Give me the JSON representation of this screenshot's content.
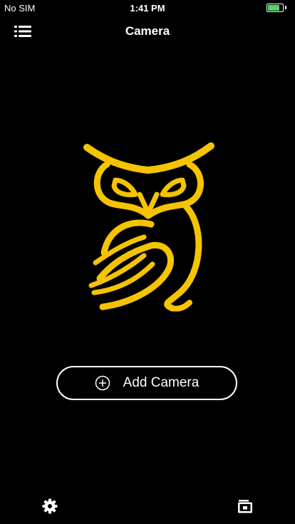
{
  "status_bar": {
    "carrier": "No SIM",
    "time": "1:41 PM",
    "battery_level": 0.9,
    "battery_color": "#4cd964"
  },
  "header": {
    "title": "Camera",
    "menu_icon": "list-menu-icon"
  },
  "logo": {
    "icon": "owl-logo",
    "color": "#f5c400"
  },
  "main": {
    "add_camera_label": "Add Camera",
    "add_camera_icon": "plus-circle-icon"
  },
  "bottom_bar": {
    "left_icon": "gear-icon",
    "right_icon": "folder-icon"
  }
}
